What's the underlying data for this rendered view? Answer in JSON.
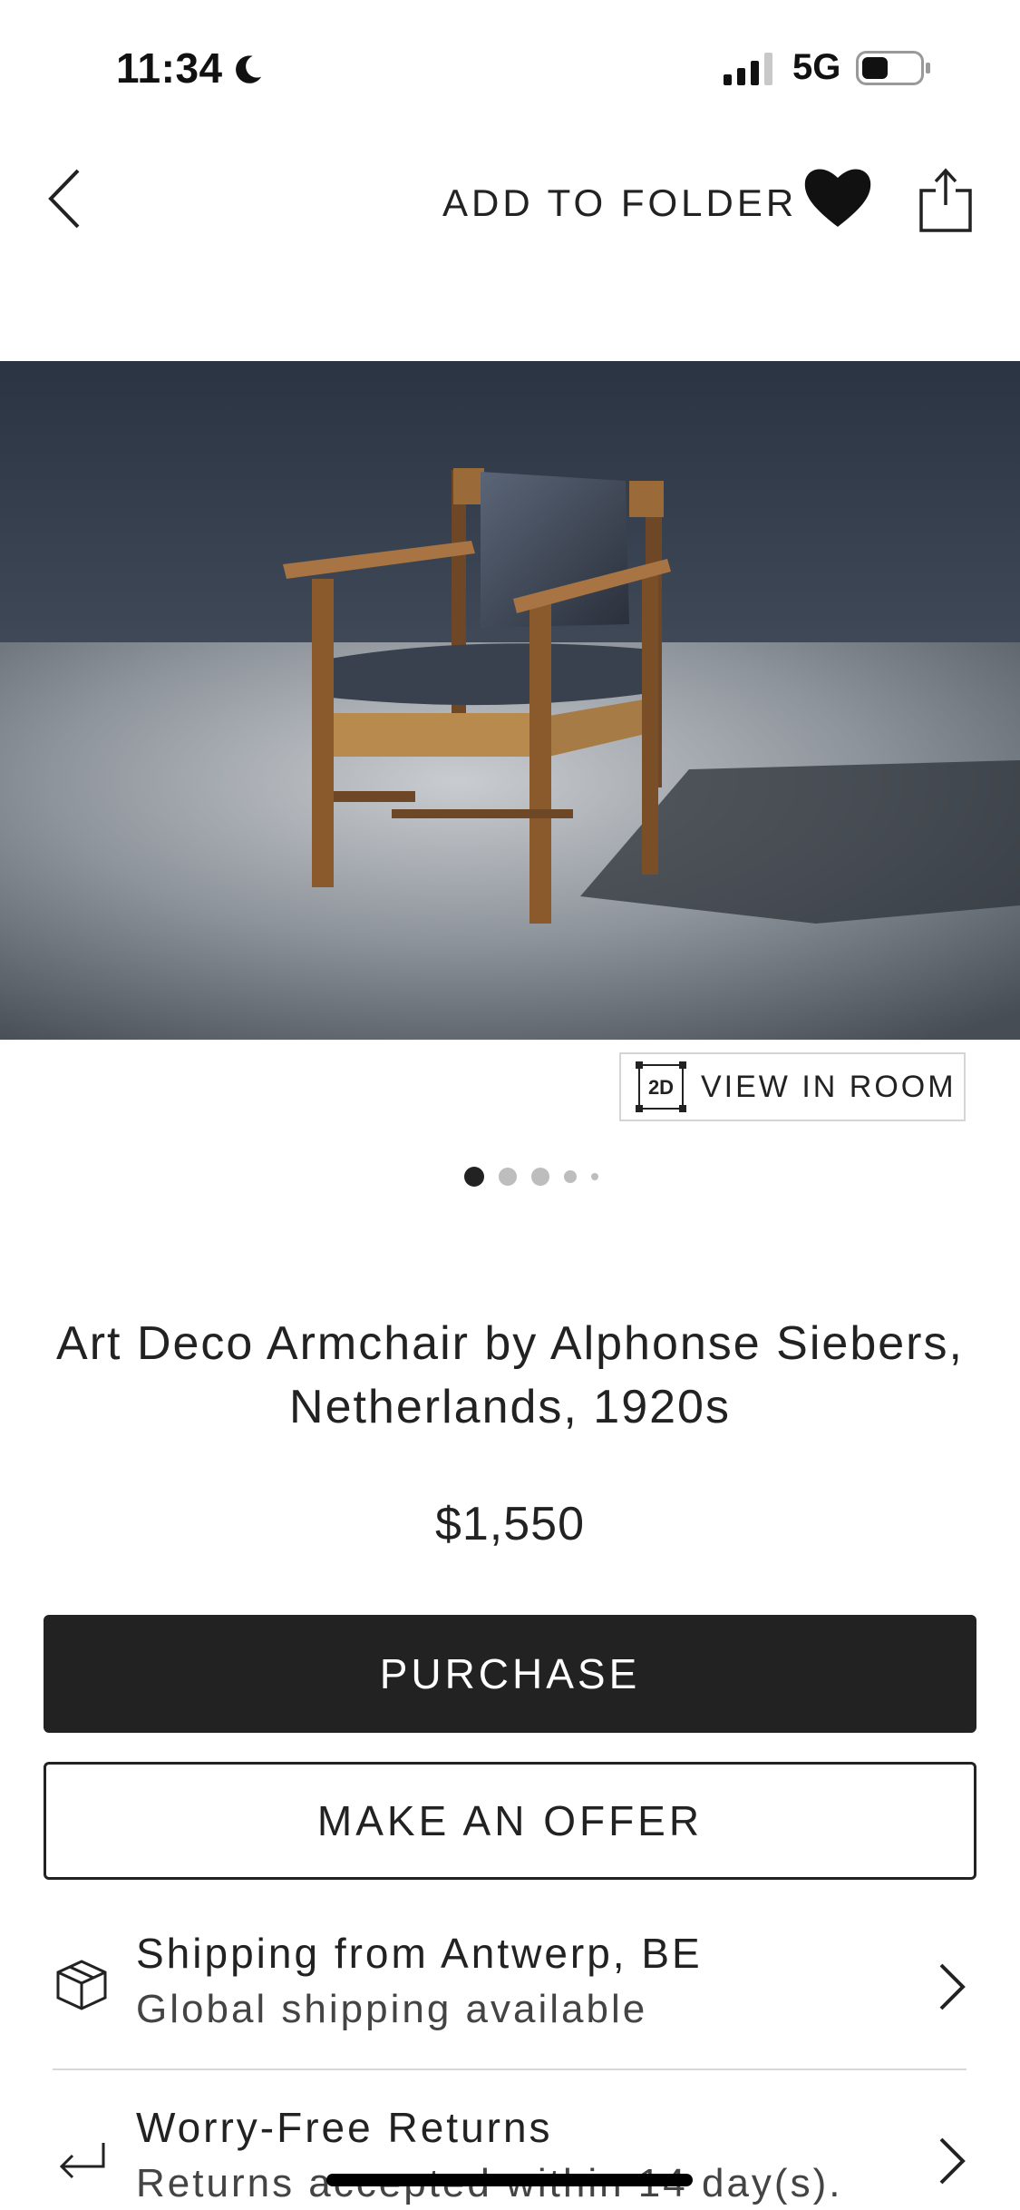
{
  "status_bar": {
    "time": "11:34",
    "network": "5G",
    "icons": [
      "moon-icon",
      "signal-icon",
      "battery-icon"
    ]
  },
  "nav": {
    "add_to_folder": "ADD TO FOLDER",
    "icons": [
      "back-chevron-icon",
      "heart-icon",
      "share-icon"
    ]
  },
  "gallery": {
    "view_in_room_badge": "2D",
    "view_in_room_label": "VIEW IN ROOM",
    "image_count_dots": 5,
    "active_index": 1
  },
  "product": {
    "title": "Art Deco Armchair by Alphonse Siebers, Netherlands, 1920s",
    "price": "$1,550"
  },
  "actions": {
    "purchase": "PURCHASE",
    "make_offer": "MAKE AN OFFER"
  },
  "info": {
    "shipping_title": "Shipping from Antwerp, BE",
    "shipping_sub": "Global shipping available",
    "returns_title": "Worry-Free Returns",
    "returns_sub": "Returns accepted within 14 day(s)."
  },
  "colors": {
    "primary_button": "#222222",
    "background": "#ffffff",
    "divider": "#d8d8d8"
  }
}
